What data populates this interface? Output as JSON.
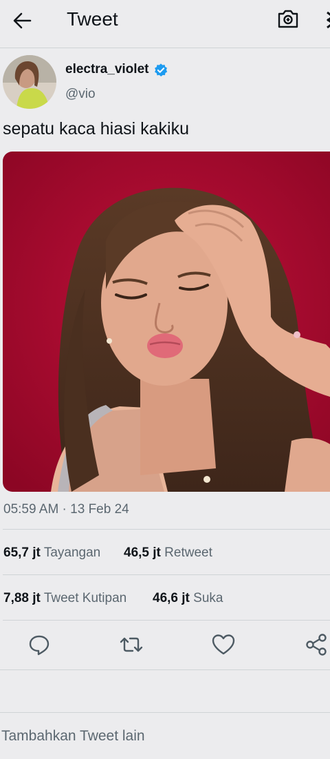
{
  "header": {
    "title": "Tweet",
    "back_icon": "arrow-left-icon",
    "camera_icon": "camera-icon"
  },
  "tweet": {
    "author_name": "electra_violet",
    "handle": "@vio",
    "verified": true,
    "text": "sepatu kaca hiasi kakiku",
    "timestamp": "05:59 AM · 13 Feb 24",
    "stats": [
      {
        "value": "65,7 jt",
        "label": "Tayangan"
      },
      {
        "value": "46,5 jt",
        "label": "Retweet"
      },
      {
        "value": "7,88 jt",
        "label": "Tweet Kutipan"
      },
      {
        "value": "46,6 jt",
        "label": "Suka"
      }
    ]
  },
  "actions": [
    "reply-icon",
    "retweet-icon",
    "like-icon",
    "share-icon"
  ],
  "footer": {
    "add_tweet_placeholder": "Tambahkan Tweet lain"
  },
  "colors": {
    "accent": "#1d9bf0",
    "media_background": "#a3082a"
  }
}
